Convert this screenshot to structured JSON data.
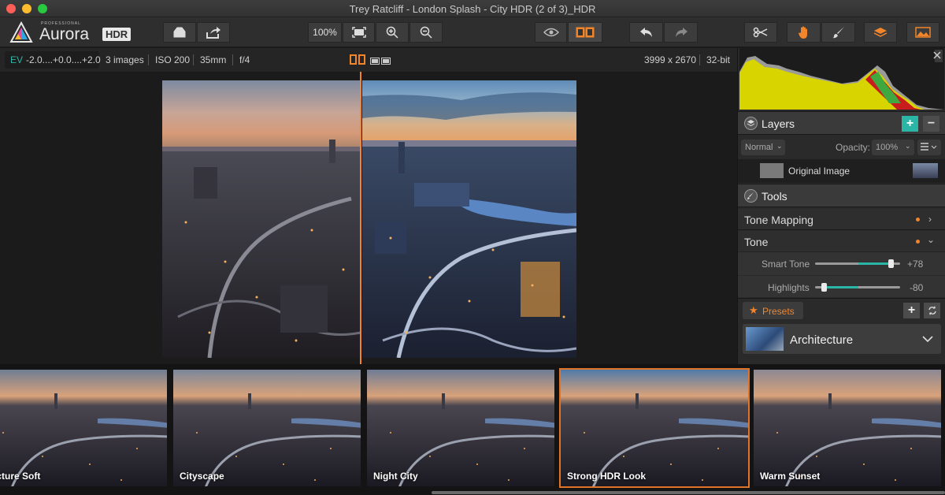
{
  "window": {
    "title": "Trey Ratcliff - London Splash - City HDR (2 of 3)_HDR"
  },
  "logo": {
    "pro": "PROFESSIONAL",
    "name": "Aurora",
    "badge": "HDR"
  },
  "toolbar": {
    "zoom_label": "100%"
  },
  "info": {
    "ev_prefix": "EV",
    "ev_range": "-2.0....+0.0....+2.0",
    "images": "3 images",
    "iso": "ISO 200",
    "focal": "35mm",
    "aperture": "f/4",
    "dimensions": "3999 x 2670",
    "bitdepth": "32-bit"
  },
  "layers": {
    "title": "Layers",
    "blend_mode": "Normal",
    "opacity_label": "Opacity:",
    "opacity_value": "100%",
    "layer_name": "Original Image"
  },
  "tools": {
    "title": "Tools",
    "sections": [
      {
        "label": "Tone Mapping",
        "expanded": false
      },
      {
        "label": "Tone",
        "expanded": true
      }
    ],
    "sliders": [
      {
        "label": "Smart Tone",
        "value": "+78",
        "level": 0.89
      },
      {
        "label": "Highlights",
        "value": "-80",
        "level": 0.1
      }
    ]
  },
  "presets": {
    "button_label": "Presets",
    "current": "Architecture",
    "items": [
      {
        "label": "hitecture Soft",
        "selected": false
      },
      {
        "label": "Cityscape",
        "selected": false
      },
      {
        "label": "Night City",
        "selected": false
      },
      {
        "label": "Strong HDR Look",
        "selected": true
      },
      {
        "label": "Warm Sunset",
        "selected": false
      }
    ]
  },
  "colors": {
    "accent": "#f2852a",
    "teal": "#2bb5a6",
    "add_button": "#2bb5a6"
  }
}
